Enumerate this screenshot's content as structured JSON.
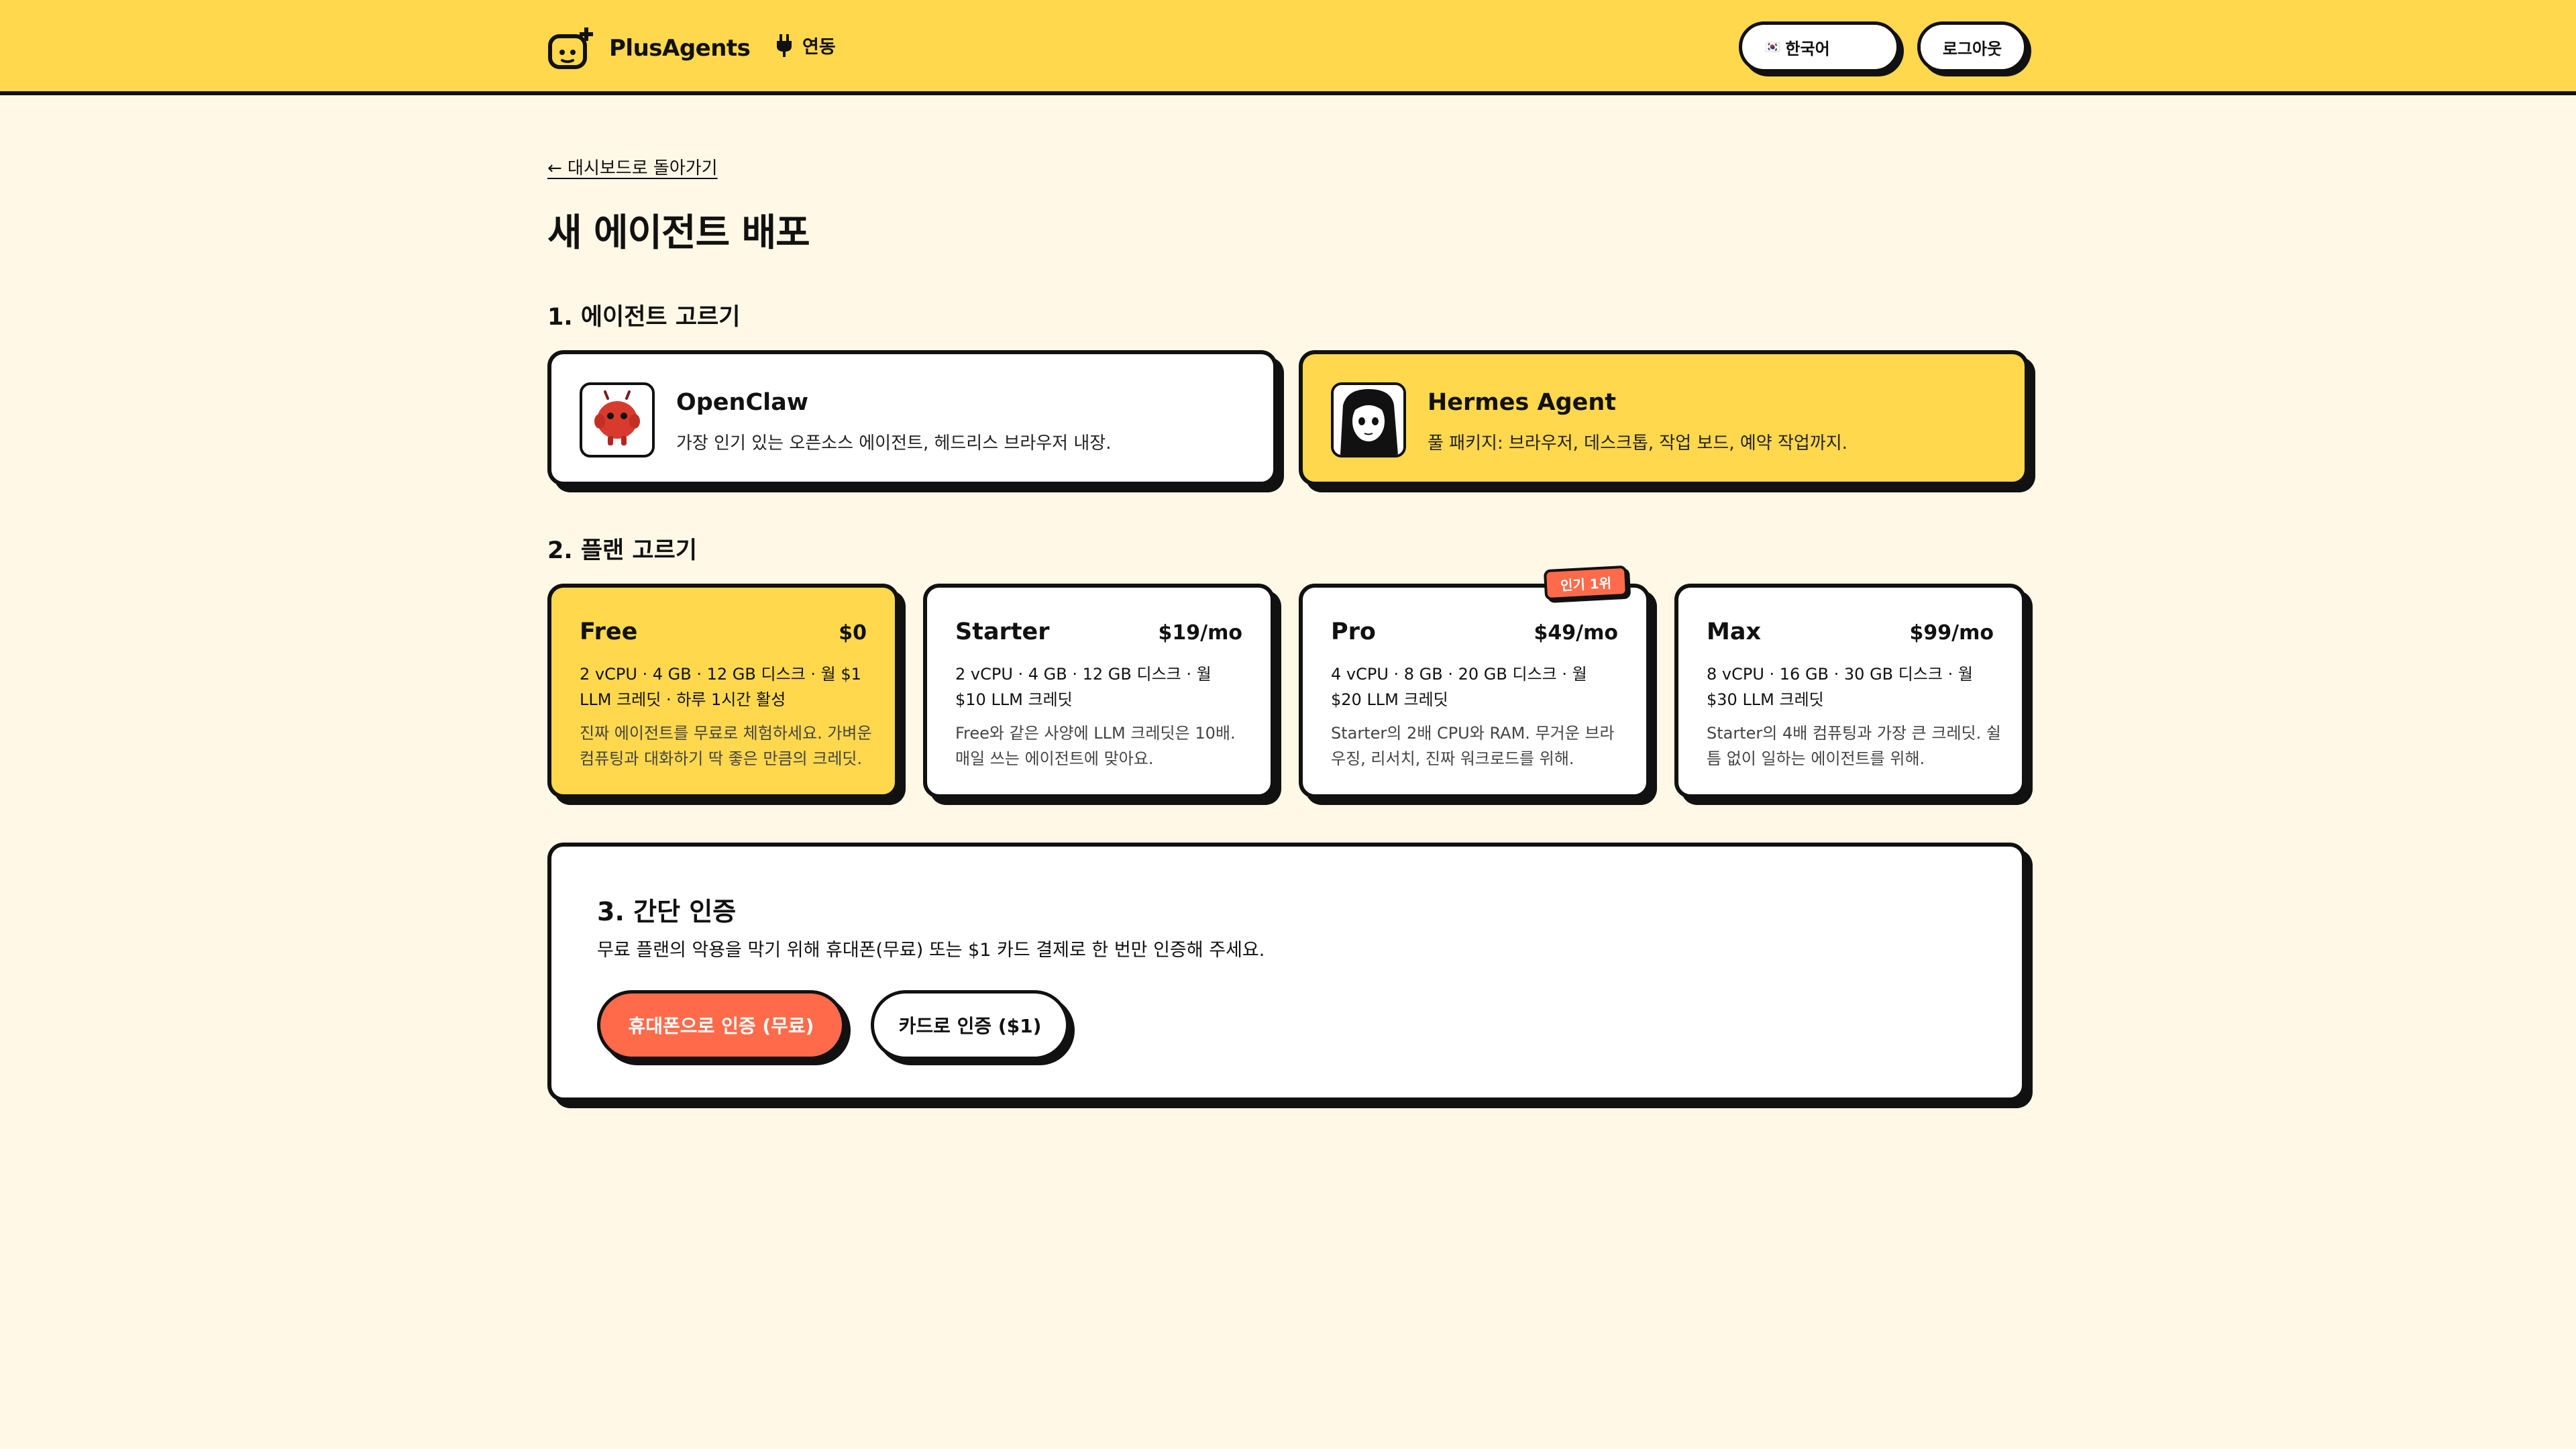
{
  "header": {
    "brand": "PlusAgents",
    "connect_label": "연동",
    "language": "한국어",
    "logout": "로그아웃"
  },
  "back_link": "← 대시보드로 돌아가기",
  "page_title": "새 에이전트 배포",
  "sections": {
    "agent": "1. 에이전트 고르기",
    "plan": "2. 플랜 고르기"
  },
  "agents": [
    {
      "name": "OpenClaw",
      "desc": "가장 인기 있는 오픈소스 에이전트, 헤드리스 브라우저 내장.",
      "selected": false
    },
    {
      "name": "Hermes Agent",
      "desc": "풀 패키지: 브라우저, 데스크톱, 작업 보드, 예약 작업까지.",
      "selected": true
    }
  ],
  "plans": [
    {
      "name": "Free",
      "price": "$0",
      "specs": "2 vCPU · 4 GB · 12 GB 디스크 · 월 $1 LLM 크레딧 · 하루 1시간 활성",
      "desc": "진짜 에이전트를 무료로 체험하세요. 가벼운 컴퓨팅과 대화하기 딱 좋은 만큼의 크레딧.",
      "selected": true
    },
    {
      "name": "Starter",
      "price": "$19/mo",
      "specs": "2 vCPU · 4 GB · 12 GB 디스크 · 월 $10 LLM 크레딧",
      "desc": "Free와 같은 사양에 LLM 크레딧은 10배. 매일 쓰는 에이전트에 맞아요.",
      "selected": false
    },
    {
      "name": "Pro",
      "price": "$49/mo",
      "specs": "4 vCPU · 8 GB · 20 GB 디스크 · 월 $20 LLM 크레딧",
      "desc": "Starter의 2배 CPU와 RAM. 무거운 브라우징, 리서치, 진짜 워크로드를 위해.",
      "selected": false,
      "badge": "인기 1위"
    },
    {
      "name": "Max",
      "price": "$99/mo",
      "specs": "8 vCPU · 16 GB · 30 GB 디스크 · 월 $30 LLM 크레딧",
      "desc": "Starter의 4배 컴퓨팅과 가장 큰 크레딧. 쉴 틈 없이 일하는 에이전트를 위해.",
      "selected": false
    }
  ],
  "verify": {
    "title": "3. 간단 인증",
    "desc": "무료 플랜의 악용을 막기 위해 휴대폰(무료) 또는 $1 카드 결제로 한 번만 인증해 주세요.",
    "phone_button": "휴대폰으로 인증 (무료)",
    "card_button": "카드로 인증 ($1)"
  },
  "colors": {
    "accent_yellow": "#ffd84d",
    "accent_orange": "#ff6b4a",
    "background": "#fff8e6",
    "ink": "#111111"
  }
}
